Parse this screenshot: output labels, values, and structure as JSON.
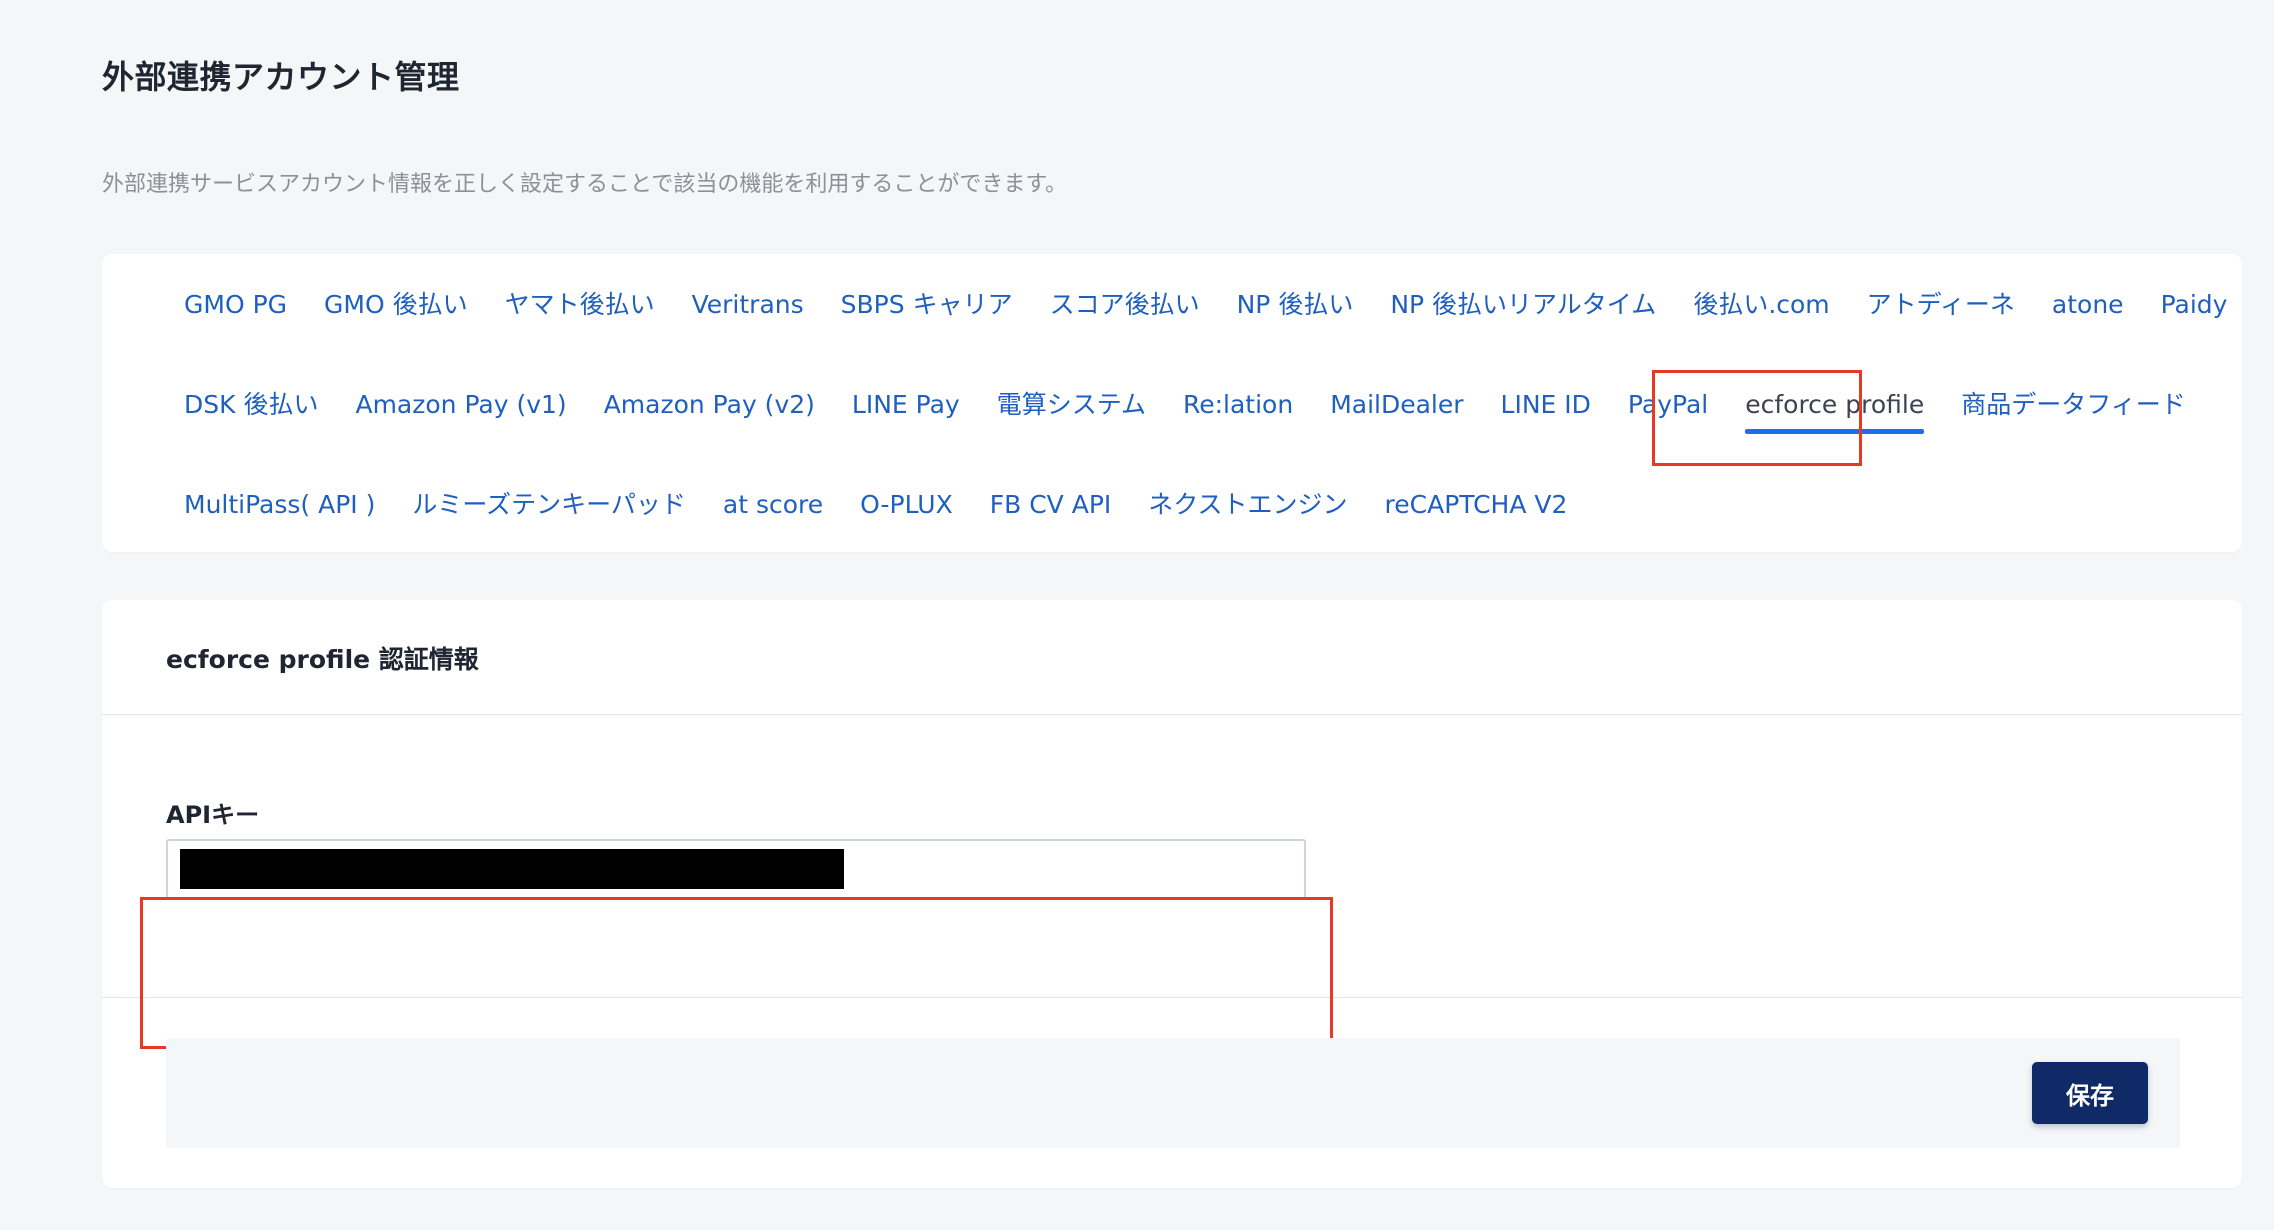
{
  "page": {
    "title": "外部連携アカウント管理",
    "description": "外部連携サービスアカウント情報を正しく設定することで該当の機能を利用することができます。"
  },
  "tabs": {
    "rows": [
      [
        {
          "label": "GMO PG",
          "active": false
        },
        {
          "label": "GMO 後払い",
          "active": false
        },
        {
          "label": "ヤマト後払い",
          "active": false
        },
        {
          "label": "Veritrans",
          "active": false
        },
        {
          "label": "SBPS キャリア",
          "active": false
        },
        {
          "label": "スコア後払い",
          "active": false
        },
        {
          "label": "NP 後払い",
          "active": false
        },
        {
          "label": "NP 後払いリアルタイム",
          "active": false
        },
        {
          "label": "後払い.com",
          "active": false
        },
        {
          "label": "アトディーネ",
          "active": false
        },
        {
          "label": "atone",
          "active": false
        },
        {
          "label": "Paidy",
          "active": false
        }
      ],
      [
        {
          "label": "DSK 後払い",
          "active": false
        },
        {
          "label": "Amazon Pay (v1)",
          "active": false
        },
        {
          "label": "Amazon Pay (v2)",
          "active": false
        },
        {
          "label": "LINE Pay",
          "active": false
        },
        {
          "label": "電算システム",
          "active": false
        },
        {
          "label": "Re:lation",
          "active": false
        },
        {
          "label": "MailDealer",
          "active": false
        },
        {
          "label": "LINE ID",
          "active": false
        },
        {
          "label": "PayPal",
          "active": false
        },
        {
          "label": "ecforce profile",
          "active": true
        },
        {
          "label": "商品データフィード",
          "active": false
        }
      ],
      [
        {
          "label": "MultiPass( API )",
          "active": false
        },
        {
          "label": "ルミーズテンキーパッド",
          "active": false
        },
        {
          "label": "at score",
          "active": false
        },
        {
          "label": "O-PLUX",
          "active": false
        },
        {
          "label": "FB CV API",
          "active": false
        },
        {
          "label": "ネクストエンジン",
          "active": false
        },
        {
          "label": "reCAPTCHA V2",
          "active": false
        }
      ]
    ]
  },
  "form": {
    "section_title": "ecforce profile 認証情報",
    "api_key_label": "APIキー",
    "api_key_value": "",
    "save_label": "保存"
  },
  "colors": {
    "link": "#1f5fbf",
    "active_underline": "#1b6fe8",
    "highlight": "#e53a24",
    "save_button": "#0f2a66",
    "page_background": "#f5f6f8"
  }
}
